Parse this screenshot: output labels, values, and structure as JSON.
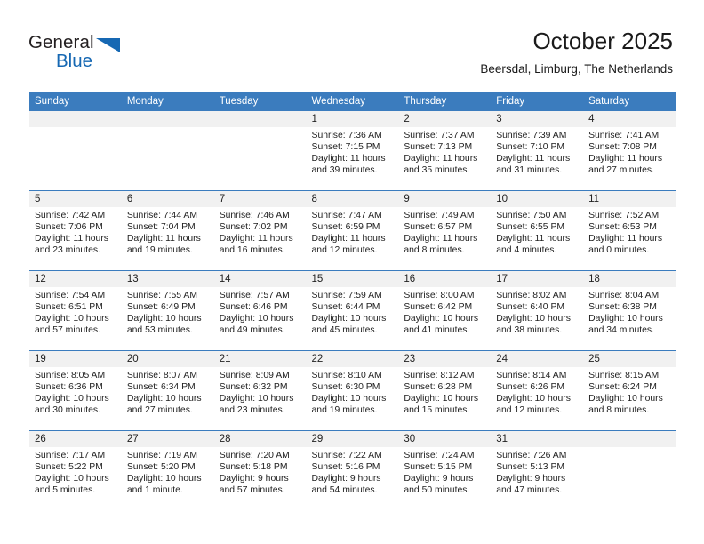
{
  "logo": {
    "word_top": "General",
    "word_bottom": "Blue",
    "triangle_color": "#1668b3",
    "icon": "general-blue-logo"
  },
  "header": {
    "title": "October 2025",
    "subtitle": "Beersdal, Limburg, The Netherlands"
  },
  "theme": {
    "header_blue": "#3b7cbe",
    "daynum_gray": "#f1f1f1",
    "text": "#222222"
  },
  "weekday_headers": [
    "Sunday",
    "Monday",
    "Tuesday",
    "Wednesday",
    "Thursday",
    "Friday",
    "Saturday"
  ],
  "weeks": [
    [
      {
        "day": "",
        "sunrise": "",
        "sunset": "",
        "daylight_1": "",
        "daylight_2": ""
      },
      {
        "day": "",
        "sunrise": "",
        "sunset": "",
        "daylight_1": "",
        "daylight_2": ""
      },
      {
        "day": "",
        "sunrise": "",
        "sunset": "",
        "daylight_1": "",
        "daylight_2": ""
      },
      {
        "day": "1",
        "sunrise": "Sunrise: 7:36 AM",
        "sunset": "Sunset: 7:15 PM",
        "daylight_1": "Daylight: 11 hours",
        "daylight_2": "and 39 minutes."
      },
      {
        "day": "2",
        "sunrise": "Sunrise: 7:37 AM",
        "sunset": "Sunset: 7:13 PM",
        "daylight_1": "Daylight: 11 hours",
        "daylight_2": "and 35 minutes."
      },
      {
        "day": "3",
        "sunrise": "Sunrise: 7:39 AM",
        "sunset": "Sunset: 7:10 PM",
        "daylight_1": "Daylight: 11 hours",
        "daylight_2": "and 31 minutes."
      },
      {
        "day": "4",
        "sunrise": "Sunrise: 7:41 AM",
        "sunset": "Sunset: 7:08 PM",
        "daylight_1": "Daylight: 11 hours",
        "daylight_2": "and 27 minutes."
      }
    ],
    [
      {
        "day": "5",
        "sunrise": "Sunrise: 7:42 AM",
        "sunset": "Sunset: 7:06 PM",
        "daylight_1": "Daylight: 11 hours",
        "daylight_2": "and 23 minutes."
      },
      {
        "day": "6",
        "sunrise": "Sunrise: 7:44 AM",
        "sunset": "Sunset: 7:04 PM",
        "daylight_1": "Daylight: 11 hours",
        "daylight_2": "and 19 minutes."
      },
      {
        "day": "7",
        "sunrise": "Sunrise: 7:46 AM",
        "sunset": "Sunset: 7:02 PM",
        "daylight_1": "Daylight: 11 hours",
        "daylight_2": "and 16 minutes."
      },
      {
        "day": "8",
        "sunrise": "Sunrise: 7:47 AM",
        "sunset": "Sunset: 6:59 PM",
        "daylight_1": "Daylight: 11 hours",
        "daylight_2": "and 12 minutes."
      },
      {
        "day": "9",
        "sunrise": "Sunrise: 7:49 AM",
        "sunset": "Sunset: 6:57 PM",
        "daylight_1": "Daylight: 11 hours",
        "daylight_2": "and 8 minutes."
      },
      {
        "day": "10",
        "sunrise": "Sunrise: 7:50 AM",
        "sunset": "Sunset: 6:55 PM",
        "daylight_1": "Daylight: 11 hours",
        "daylight_2": "and 4 minutes."
      },
      {
        "day": "11",
        "sunrise": "Sunrise: 7:52 AM",
        "sunset": "Sunset: 6:53 PM",
        "daylight_1": "Daylight: 11 hours",
        "daylight_2": "and 0 minutes."
      }
    ],
    [
      {
        "day": "12",
        "sunrise": "Sunrise: 7:54 AM",
        "sunset": "Sunset: 6:51 PM",
        "daylight_1": "Daylight: 10 hours",
        "daylight_2": "and 57 minutes."
      },
      {
        "day": "13",
        "sunrise": "Sunrise: 7:55 AM",
        "sunset": "Sunset: 6:49 PM",
        "daylight_1": "Daylight: 10 hours",
        "daylight_2": "and 53 minutes."
      },
      {
        "day": "14",
        "sunrise": "Sunrise: 7:57 AM",
        "sunset": "Sunset: 6:46 PM",
        "daylight_1": "Daylight: 10 hours",
        "daylight_2": "and 49 minutes."
      },
      {
        "day": "15",
        "sunrise": "Sunrise: 7:59 AM",
        "sunset": "Sunset: 6:44 PM",
        "daylight_1": "Daylight: 10 hours",
        "daylight_2": "and 45 minutes."
      },
      {
        "day": "16",
        "sunrise": "Sunrise: 8:00 AM",
        "sunset": "Sunset: 6:42 PM",
        "daylight_1": "Daylight: 10 hours",
        "daylight_2": "and 41 minutes."
      },
      {
        "day": "17",
        "sunrise": "Sunrise: 8:02 AM",
        "sunset": "Sunset: 6:40 PM",
        "daylight_1": "Daylight: 10 hours",
        "daylight_2": "and 38 minutes."
      },
      {
        "day": "18",
        "sunrise": "Sunrise: 8:04 AM",
        "sunset": "Sunset: 6:38 PM",
        "daylight_1": "Daylight: 10 hours",
        "daylight_2": "and 34 minutes."
      }
    ],
    [
      {
        "day": "19",
        "sunrise": "Sunrise: 8:05 AM",
        "sunset": "Sunset: 6:36 PM",
        "daylight_1": "Daylight: 10 hours",
        "daylight_2": "and 30 minutes."
      },
      {
        "day": "20",
        "sunrise": "Sunrise: 8:07 AM",
        "sunset": "Sunset: 6:34 PM",
        "daylight_1": "Daylight: 10 hours",
        "daylight_2": "and 27 minutes."
      },
      {
        "day": "21",
        "sunrise": "Sunrise: 8:09 AM",
        "sunset": "Sunset: 6:32 PM",
        "daylight_1": "Daylight: 10 hours",
        "daylight_2": "and 23 minutes."
      },
      {
        "day": "22",
        "sunrise": "Sunrise: 8:10 AM",
        "sunset": "Sunset: 6:30 PM",
        "daylight_1": "Daylight: 10 hours",
        "daylight_2": "and 19 minutes."
      },
      {
        "day": "23",
        "sunrise": "Sunrise: 8:12 AM",
        "sunset": "Sunset: 6:28 PM",
        "daylight_1": "Daylight: 10 hours",
        "daylight_2": "and 15 minutes."
      },
      {
        "day": "24",
        "sunrise": "Sunrise: 8:14 AM",
        "sunset": "Sunset: 6:26 PM",
        "daylight_1": "Daylight: 10 hours",
        "daylight_2": "and 12 minutes."
      },
      {
        "day": "25",
        "sunrise": "Sunrise: 8:15 AM",
        "sunset": "Sunset: 6:24 PM",
        "daylight_1": "Daylight: 10 hours",
        "daylight_2": "and 8 minutes."
      }
    ],
    [
      {
        "day": "26",
        "sunrise": "Sunrise: 7:17 AM",
        "sunset": "Sunset: 5:22 PM",
        "daylight_1": "Daylight: 10 hours",
        "daylight_2": "and 5 minutes."
      },
      {
        "day": "27",
        "sunrise": "Sunrise: 7:19 AM",
        "sunset": "Sunset: 5:20 PM",
        "daylight_1": "Daylight: 10 hours",
        "daylight_2": "and 1 minute."
      },
      {
        "day": "28",
        "sunrise": "Sunrise: 7:20 AM",
        "sunset": "Sunset: 5:18 PM",
        "daylight_1": "Daylight: 9 hours",
        "daylight_2": "and 57 minutes."
      },
      {
        "day": "29",
        "sunrise": "Sunrise: 7:22 AM",
        "sunset": "Sunset: 5:16 PM",
        "daylight_1": "Daylight: 9 hours",
        "daylight_2": "and 54 minutes."
      },
      {
        "day": "30",
        "sunrise": "Sunrise: 7:24 AM",
        "sunset": "Sunset: 5:15 PM",
        "daylight_1": "Daylight: 9 hours",
        "daylight_2": "and 50 minutes."
      },
      {
        "day": "31",
        "sunrise": "Sunrise: 7:26 AM",
        "sunset": "Sunset: 5:13 PM",
        "daylight_1": "Daylight: 9 hours",
        "daylight_2": "and 47 minutes."
      },
      {
        "day": "",
        "sunrise": "",
        "sunset": "",
        "daylight_1": "",
        "daylight_2": ""
      }
    ]
  ]
}
